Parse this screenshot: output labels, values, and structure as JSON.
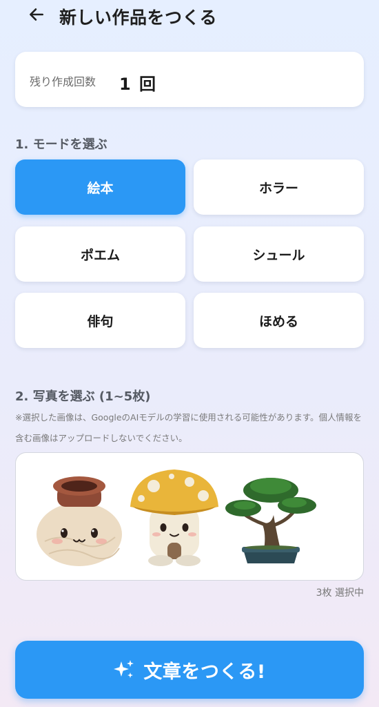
{
  "header": {
    "title": "新しい作品をつくる",
    "back_icon": "arrow-left-icon"
  },
  "remaining": {
    "label": "残り作成回数",
    "count": "1 回"
  },
  "mode_section": {
    "title": "1. モードを選ぶ",
    "selected": "絵本",
    "options": [
      "絵本",
      "ホラー",
      "ポエム",
      "シュール",
      "俳句",
      "ほめる"
    ]
  },
  "photo_section": {
    "title": "2. 写真を選ぶ (1~5枚)",
    "note": "※選択した画像は、GoogleのAIモデルの学習に使用される可能性があります。個人情報を含む画像はアップロードしないでください。",
    "photos": [
      "pot-character-photo",
      "mushroom-character-photo",
      "bonsai-photo"
    ],
    "selected_count": "3枚 選択中"
  },
  "generate_button": {
    "label": "文章をつくる!",
    "icon": "sparkle-icon"
  },
  "colors": {
    "accent": "#2b98f5",
    "card": "#ffffff",
    "text": "#1a1a1a"
  }
}
